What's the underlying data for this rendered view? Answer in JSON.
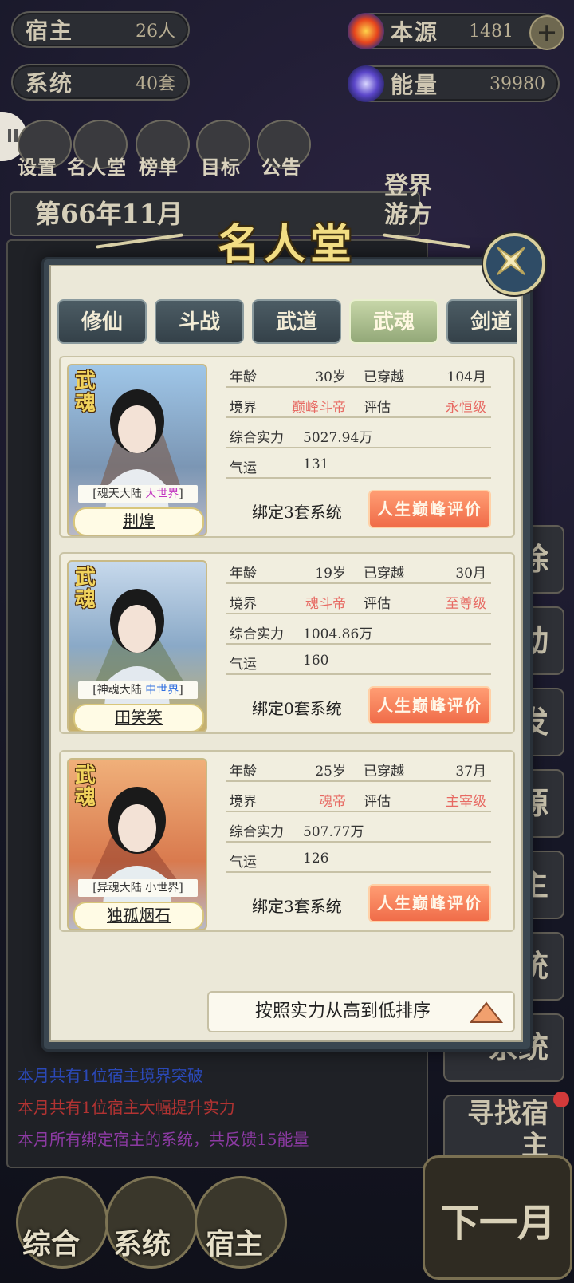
{
  "hud": {
    "host_label": "宿主",
    "host_value": "26人",
    "system_label": "系统",
    "system_value": "40套",
    "origin_label": "本源",
    "origin_value": "1481",
    "energy_label": "能量",
    "energy_value": "39980"
  },
  "menu": [
    "设置",
    "名人堂",
    "榜单",
    "目标",
    "公告"
  ],
  "date": "第66年11月",
  "travel_button": "登界游方",
  "side_buttons": [
    "除",
    "动",
    "发",
    "源",
    "主",
    "统",
    "系统",
    "寻找宿主"
  ],
  "log_lines": [
    {
      "text": "本月共有1位宿主境界突破",
      "color": "#2b49b8"
    },
    {
      "text": "本月共有1位宿主大幅提升实力",
      "color": "#b23332"
    },
    {
      "text": "本月所有绑定宿主的系统，共反馈15能量",
      "color": "#8c3aa3"
    }
  ],
  "bottom_nav": [
    "综合",
    "系统",
    "宿主"
  ],
  "next_month": "下一月",
  "modal": {
    "title": "名人堂",
    "tabs": [
      "修仙",
      "斗战",
      "武道",
      "武魂",
      "剑道"
    ],
    "active_tab": "武魂",
    "sort_label": "按照实力从高到低排序",
    "labels": {
      "age": "年龄",
      "crossed": "已穿越",
      "realm": "境界",
      "eval": "评估",
      "strength": "综合实力",
      "luck": "气运",
      "eval_button": "人生巅峰评价"
    },
    "cards": [
      {
        "badge": "武魂",
        "world_prefix": "[魂天大陆 ",
        "world_size": "大世界",
        "world_suffix": "]",
        "world_color": "#c235c0",
        "name": "荆煌",
        "age": "30岁",
        "crossed": "104月",
        "realm": "巅峰斗帝",
        "eval": "永恒级",
        "strength": "5027.94万",
        "luck": "131",
        "bind": "绑定3套系统",
        "bg_color": "#8fb5d8"
      },
      {
        "badge": "武魂",
        "world_prefix": "[神魂大陆 ",
        "world_size": "中世界",
        "world_suffix": "]",
        "world_color": "#2f6fe0",
        "name": "田笑笑",
        "age": "19岁",
        "crossed": "30月",
        "realm": "魂斗帝",
        "eval": "至尊级",
        "strength": "1004.86万",
        "luck": "160",
        "bind": "绑定0套系统",
        "bg_color": "#b7cde5"
      },
      {
        "badge": "武魂",
        "world_prefix": "[异魂大陆 ",
        "world_size": "小世界",
        "world_suffix": "]",
        "world_color": "#333333",
        "name": "独孤烟石",
        "age": "25岁",
        "crossed": "37月",
        "realm": "魂帝",
        "eval": "主宰级",
        "strength": "507.77万",
        "luck": "126",
        "bind": "绑定3套系统",
        "bg_color": "#e9a36d"
      }
    ]
  }
}
